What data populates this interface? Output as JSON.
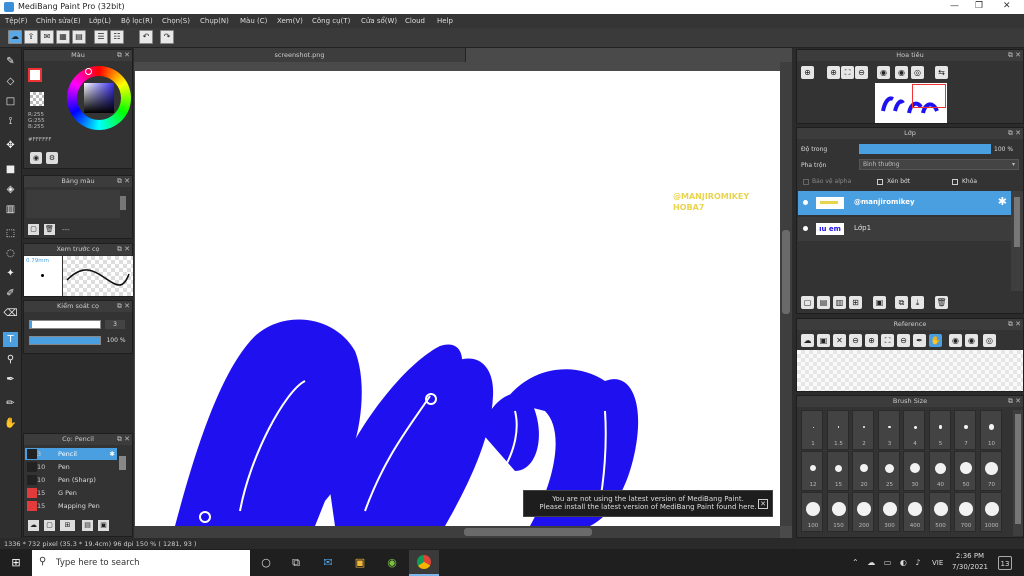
{
  "window": {
    "title": "MediBang Paint Pro (32bit)",
    "minimize": "—",
    "maximize": "❐",
    "close": "✕"
  },
  "menu": [
    "Tệp(F)",
    "Chỉnh sửa(E)",
    "Lớp(L)",
    "Bộ lọc(R)",
    "Chọn(S)",
    "Chụp(N)",
    "Màu (C)",
    "Xem(V)",
    "Công cụ(T)",
    "Cửa sổ(W)",
    "Cloud",
    "Help"
  ],
  "document": {
    "tab": "screenshot.png"
  },
  "color_panel": {
    "title": "Màu",
    "r": "R:255",
    "g": "G:255",
    "b": "B:255",
    "hex": "#FFFFFF"
  },
  "palette_panel": {
    "title": "Bảng màu",
    "dash": "---"
  },
  "brush_preview": {
    "title": "Xem trước cọ",
    "size": "0.79mm"
  },
  "brush_control": {
    "title": "Kiểm soát cọ",
    "size_value": "3",
    "opacity_value": "100 %"
  },
  "brush_list": {
    "title": "Cọ: Pencil",
    "items": [
      {
        "size": "3",
        "name": "Pencil",
        "color": "#222222",
        "selected": true
      },
      {
        "size": "10",
        "name": "Pen",
        "color": "#222222",
        "selected": false
      },
      {
        "size": "10",
        "name": "Pen (Sharp)",
        "color": "#222222",
        "selected": false
      },
      {
        "size": "15",
        "name": "G Pen",
        "color": "#e23b3b",
        "selected": false
      },
      {
        "size": "15",
        "name": "Mapping Pen",
        "color": "#e23b3b",
        "selected": false
      }
    ]
  },
  "canvas_watermark": {
    "line1": "@MANJIROMIKEY",
    "line2": "HOBA7"
  },
  "notice": {
    "line1": "You are not using the latest version of MediBang Paint.",
    "line2": "Please install the latest version of MediBang Paint found here."
  },
  "status": {
    "text": "1336 * 732 pixel  (35.3 * 19.4cm)  96 dpi  150 %  ( 1281, 93 )"
  },
  "navigator": {
    "title": "Hoa tiêu"
  },
  "layer_panel": {
    "title": "Lớp",
    "opacity_label": "Độ trong",
    "opacity_value": "100 %",
    "blend_label": "Pha trộn",
    "blend_value": "Bình thường",
    "protect_alpha": "Bảo vệ alpha",
    "clipping": "Xén bớt",
    "lock": "Khóa",
    "layers": [
      {
        "name": "@manjiromikey",
        "selected": true
      },
      {
        "name": "Lớp1",
        "selected": false
      }
    ]
  },
  "reference_panel": {
    "title": "Reference"
  },
  "brush_size_panel": {
    "title": "Brush Size",
    "sizes": [
      "1",
      "1.5",
      "2",
      "3",
      "4",
      "5",
      "7",
      "10",
      "12",
      "15",
      "20",
      "25",
      "30",
      "40",
      "50",
      "70",
      "100",
      "150",
      "200",
      "300",
      "400",
      "500",
      "700",
      "1000"
    ]
  },
  "taskbar": {
    "search_placeholder": "Type here to search",
    "lang": "VIE",
    "time": "2:36 PM",
    "date": "7/30/2021",
    "notifications": "13"
  },
  "colors": {
    "canvas_blue": "#1f10f0",
    "accent": "#4a9fe0"
  }
}
